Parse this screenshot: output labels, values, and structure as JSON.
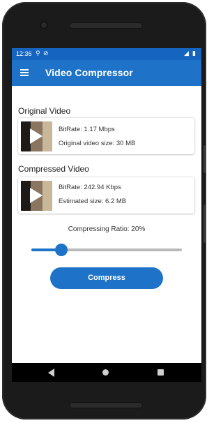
{
  "status": {
    "time": "12:36",
    "icons": [
      "cast-icon",
      "no-disturb-icon",
      "signal-icon",
      "battery-icon"
    ]
  },
  "appbar": {
    "title": "Video Compressor",
    "menu_icon": "hamburger-menu-icon"
  },
  "original": {
    "section_label": "Original Video",
    "bitrate": "BitRate: 1.17 Mbps",
    "size": "Original video size: 30 MB"
  },
  "compressed": {
    "section_label": "Compressed Video",
    "bitrate": "BitRate: 242.94 Kbps",
    "size": "Estimated size: 6.2 MB"
  },
  "ratio": {
    "label": "Compressing Ratio: 20%",
    "value_percent": 20
  },
  "compress_button": {
    "label": "Compress"
  },
  "colors": {
    "primary": "#1e73c8",
    "statusbar": "#1565c0",
    "track": "#b9b9b9"
  }
}
